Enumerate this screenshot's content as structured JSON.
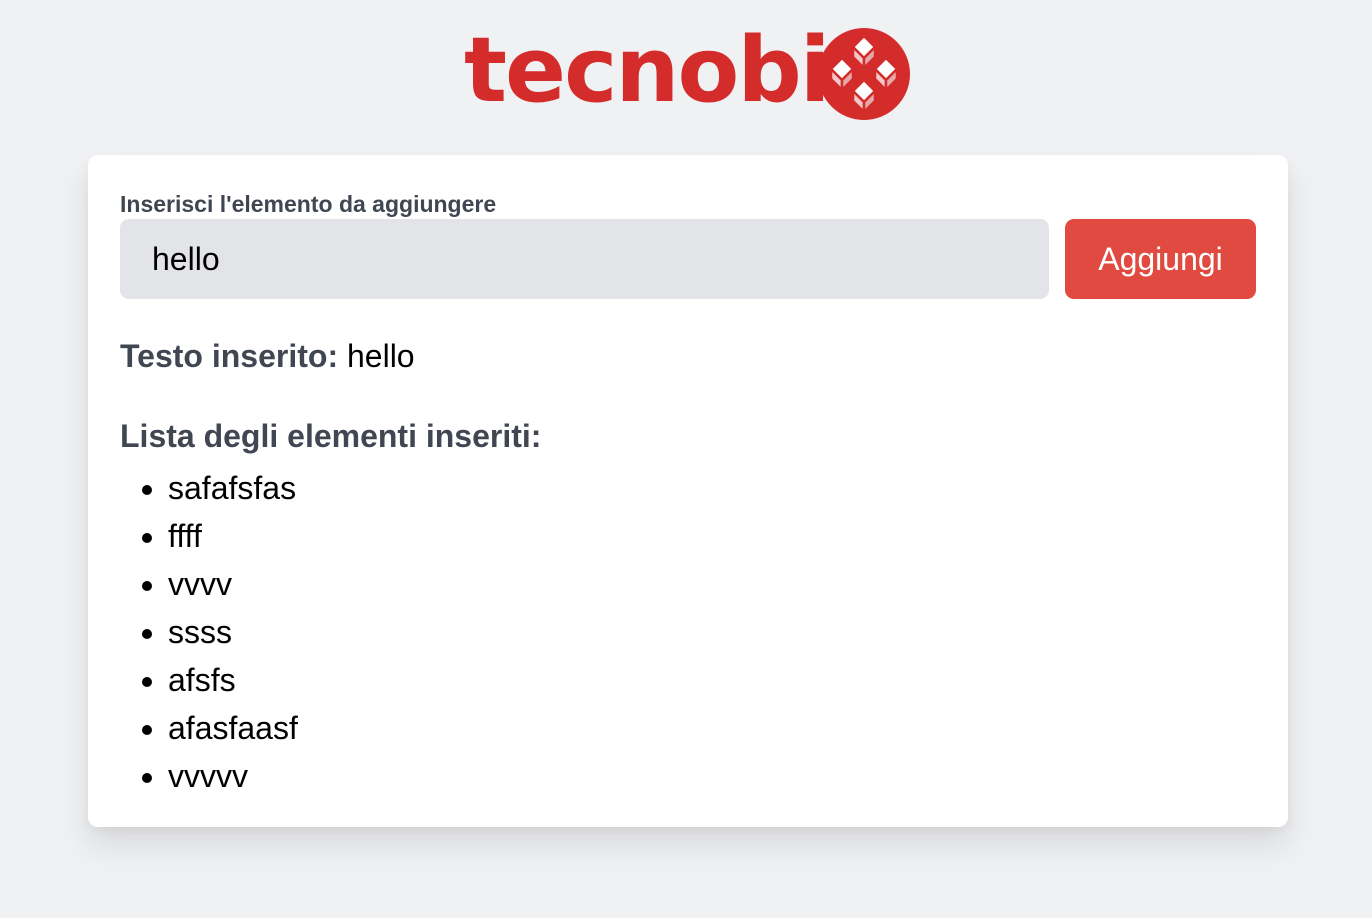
{
  "brand": {
    "name": "tecnobit",
    "color": "#d42b2b"
  },
  "form": {
    "label": "Inserisci l'elemento da aggiungere",
    "input_value": "hello",
    "button_label": "Aggiungi",
    "button_color": "#e04a40"
  },
  "echo": {
    "label": "Testo inserito:",
    "value": "hello"
  },
  "list": {
    "title": "Lista degli elementi inseriti:",
    "items": [
      "safafsfas",
      "ffff",
      "vvvv",
      "ssss",
      "afsfs",
      "afasfaasf",
      "vvvvv"
    ]
  },
  "icons": {
    "logo_mark": "tecnobit-cube-logo-icon"
  }
}
